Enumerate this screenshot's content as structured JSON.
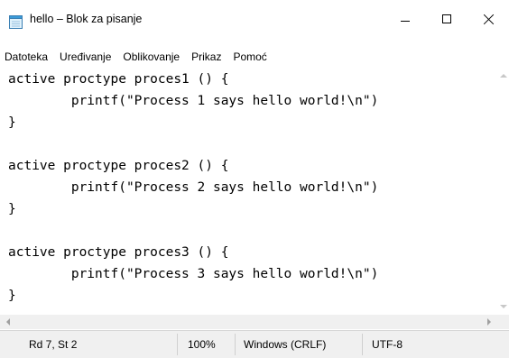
{
  "window": {
    "title": "hello – Blok za pisanje",
    "icon": "notepad-icon"
  },
  "title_controls": {
    "minimize": "minimize-icon",
    "maximize": "maximize-icon",
    "close": "close-icon"
  },
  "menu": {
    "items": [
      "Datoteka",
      "Uređivanje",
      "Oblikovanje",
      "Prikaz",
      "Pomoć"
    ]
  },
  "editor": {
    "lines": [
      "active proctype proces1 () {",
      "        printf(\"Process 1 says hello world!\\n\")",
      "}",
      "",
      "active proctype proces2 () {",
      "        printf(\"Process 2 says hello world!\\n\")",
      "}",
      "",
      "active proctype proces3 () {",
      "        printf(\"Process 3 says hello world!\\n\")",
      "}"
    ]
  },
  "statusbar": {
    "position": "Rd 7, St 2",
    "zoom": "100%",
    "line_ending": "Windows (CRLF)",
    "encoding": "UTF-8"
  }
}
